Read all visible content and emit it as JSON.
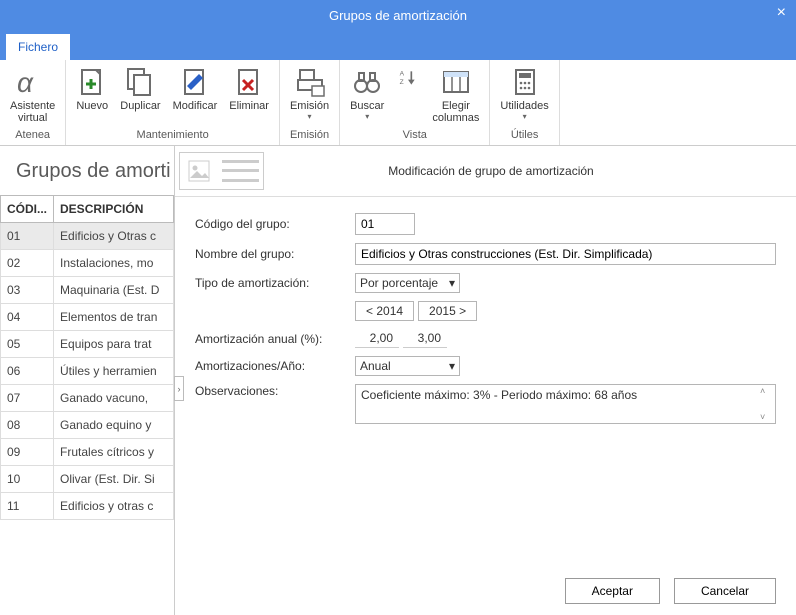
{
  "window": {
    "title": "Grupos de amortización",
    "close": "×"
  },
  "tabs": {
    "file": "Fichero"
  },
  "ribbon": {
    "groups": {
      "atenea": {
        "label": "Atenea",
        "wizard": "Asistente\nvirtual"
      },
      "mant": {
        "label": "Mantenimiento",
        "new": "Nuevo",
        "dup": "Duplicar",
        "mod": "Modificar",
        "del": "Eliminar"
      },
      "emit": {
        "label": "Emisión",
        "emit": "Emisión"
      },
      "vista": {
        "label": "Vista",
        "search": "Buscar",
        "sort": "",
        "cols": "Elegir\ncolumnas"
      },
      "utils": {
        "label": "Útiles",
        "util": "Utilidades"
      }
    }
  },
  "left": {
    "title": "Grupos de amorti",
    "cols": {
      "code": "CÓDI...",
      "desc": "DESCRIPCIÓN"
    },
    "rows": [
      {
        "code": "01",
        "desc": "Edificios y Otras c",
        "selected": true
      },
      {
        "code": "02",
        "desc": "Instalaciones, mo"
      },
      {
        "code": "03",
        "desc": "Maquinaria (Est. D"
      },
      {
        "code": "04",
        "desc": "Elementos de tran"
      },
      {
        "code": "05",
        "desc": "Equipos para trat"
      },
      {
        "code": "06",
        "desc": "Útiles y herramien"
      },
      {
        "code": "07",
        "desc": "Ganado vacuno,"
      },
      {
        "code": "08",
        "desc": "Ganado equino y"
      },
      {
        "code": "09",
        "desc": "Frutales cítricos y"
      },
      {
        "code": "10",
        "desc": "Olivar (Est. Dir. Si"
      },
      {
        "code": "11",
        "desc": "Edificios y otras c"
      }
    ]
  },
  "right": {
    "title": "Modificación de grupo de amortización",
    "labels": {
      "code": "Código del grupo:",
      "name": "Nombre del grupo:",
      "type": "Tipo de amortización:",
      "annual": "Amortización anual (%):",
      "peryear": "Amortizaciones/Año:",
      "obs": "Observaciones:"
    },
    "values": {
      "code": "01",
      "name": "Edificios y Otras construcciones (Est. Dir. Simplificada)",
      "type": "Por porcentaje",
      "year_prev": "< 2014",
      "year_next": "2015 >",
      "val_prev": "2,00",
      "val_next": "3,00",
      "peryear": "Anual",
      "obs": "Coeficiente máximo: 3% - Periodo máximo: 68 años"
    }
  },
  "footer": {
    "ok": "Aceptar",
    "cancel": "Cancelar"
  },
  "glyphs": {
    "dd": "▾",
    "up": "˄",
    "down": "˅",
    "right": "›"
  }
}
